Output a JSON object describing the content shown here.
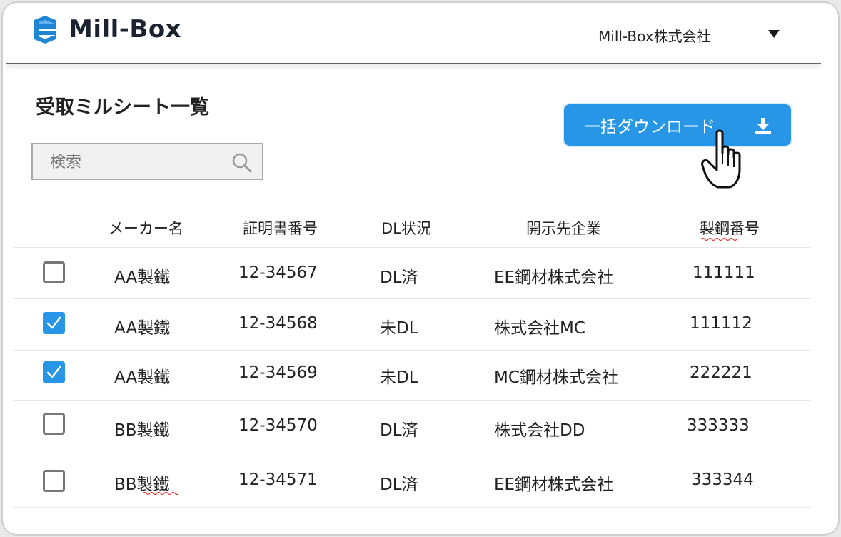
{
  "header": {
    "logo_text": "Mill-Box",
    "company_name": "Mill-Box株式会社"
  },
  "page": {
    "title": "受取ミルシート一覧",
    "search_placeholder": "検索",
    "bulk_download_label": "一括ダウンロード"
  },
  "table": {
    "columns": [
      "メーカー名",
      "証明書番号",
      "DL状況",
      "開示先企業",
      "製鋼番号"
    ],
    "rows": [
      {
        "checked": false,
        "maker": "AA製鐵",
        "cert_no": "12-34567",
        "dl_status": "DL済",
        "company": "EE鋼材株式会社",
        "steel_no": "111111"
      },
      {
        "checked": true,
        "maker": "AA製鐵",
        "cert_no": "12-34568",
        "dl_status": "未DL",
        "company": "株式会社MC",
        "steel_no": "111112"
      },
      {
        "checked": true,
        "maker": "AA製鐵",
        "cert_no": "12-34569",
        "dl_status": "未DL",
        "company": "MC鋼材株式会社",
        "steel_no": "222221"
      },
      {
        "checked": false,
        "maker": "BB製鐵",
        "cert_no": "12-34570",
        "dl_status": "DL済",
        "company": "株式会社DD",
        "steel_no": "333333"
      },
      {
        "checked": false,
        "maker": "BB製鐵",
        "cert_no": "12-34571",
        "dl_status": "DL済",
        "company": "EE鋼材株式会社",
        "steel_no": "333344"
      }
    ]
  },
  "colors": {
    "accent": "#2896e6",
    "logo": "#1f86d6"
  },
  "icons": [
    "logo-icon",
    "caret-down-icon",
    "search-icon",
    "download-icon",
    "hand-pointer-icon",
    "checkbox-icon"
  ]
}
